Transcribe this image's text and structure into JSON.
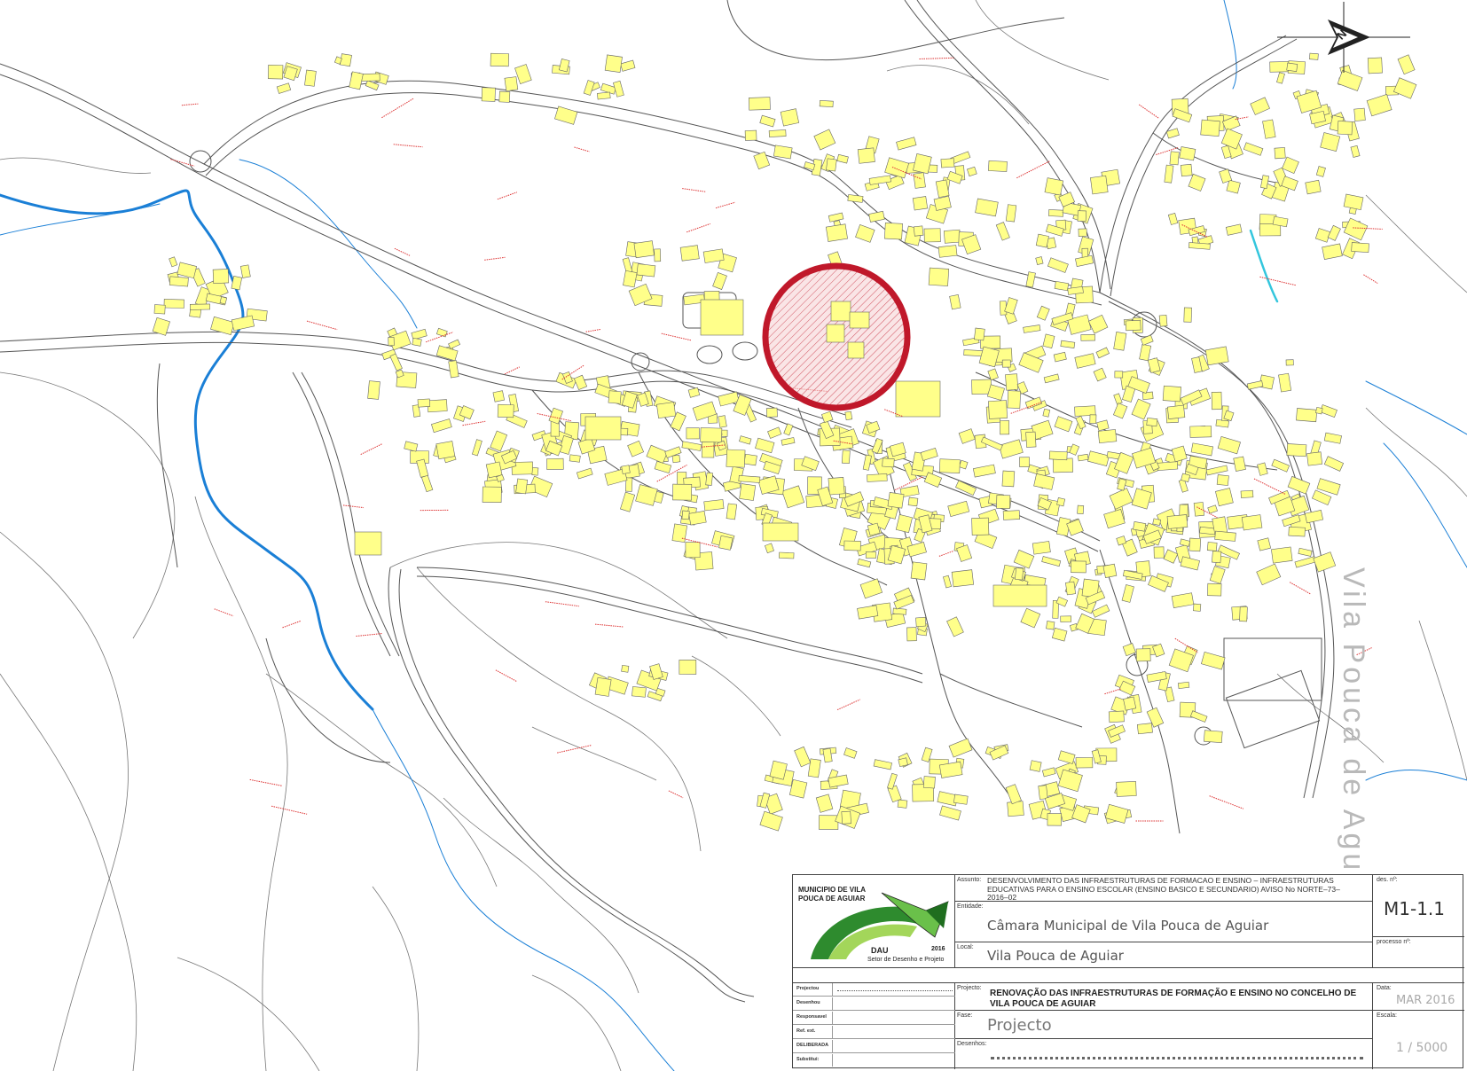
{
  "map": {
    "vertical_label": "Vila Pouca de Aguiar",
    "highlight_color": "#c0182a",
    "building_color": "#ffff8a",
    "river_color": "#1a7fd6",
    "north_arrow": "north-arrow-icon"
  },
  "title_block": {
    "municipality": "MUNICIPIO DE VILA POUCA DE AGUIAR",
    "logo_text": "DAU",
    "logo_year": "2016",
    "logo_subtitle": "Setor de Desenho e Projeto",
    "assunto_label": "Assunto:",
    "assunto": "DESENVOLVIMENTO DAS INFRAESTRUTURAS DE FORMACAO E ENSINO – INFRAESTRUTURAS EDUCATIVAS PARA O ENSINO ESCOLAR (ENSINO BASICO E SECUNDARIO) AVISO No NORTE–73–2016–02",
    "entidade_label": "Entidade:",
    "entidade": "Câmara Municipal de Vila Pouca de Aguiar",
    "local_label": "Local:",
    "local": "Vila Pouca de Aguiar",
    "des_label": "des. nº:",
    "des_number": "M1-1.1",
    "processo_label": "processo nº:",
    "roles": [
      "Projectou",
      "Desenhou",
      "Responsavel",
      "Ref. ext.",
      "DELIBERADA",
      "Substitui:"
    ],
    "projeto_label": "Projecto:",
    "projeto": "RENOVAÇÃO DAS INFRAESTRUTURAS DE FORMAÇÃO E ENSINO NO CONCELHO DE VILA POUCA DE AGUIAR",
    "fase_label": "Fase:",
    "fase": "Projecto",
    "desenhos_label": "Desenhos:",
    "data_label": "Data:",
    "data": "MAR 2016",
    "escala_label": "Escala:",
    "escala": "1 / 5000"
  }
}
